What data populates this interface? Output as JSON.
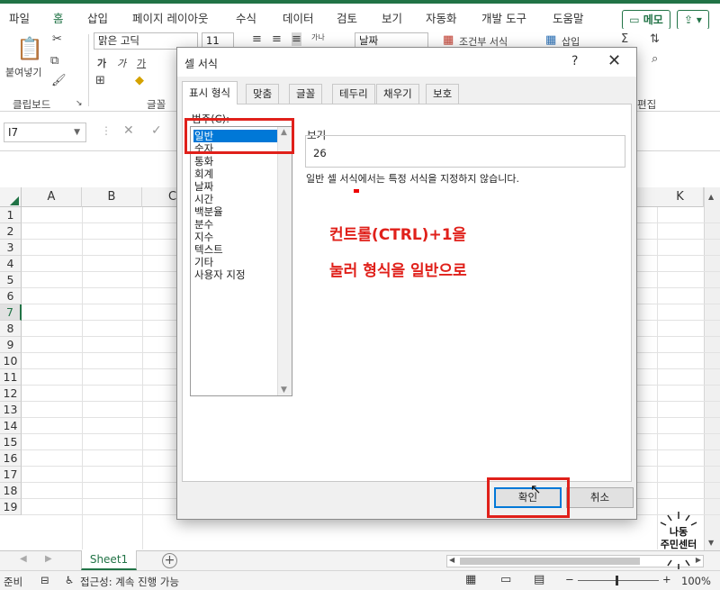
{
  "ribbon_tabs": [
    "파일",
    "홈",
    "삽입",
    "페이지 레이아웃",
    "수식",
    "데이터",
    "검토",
    "보기",
    "자동화",
    "개발 도구",
    "도움말"
  ],
  "memo_label": "메모",
  "ribbon": {
    "paste_label": "붙여넣기",
    "font_name": "맑은 고딕",
    "font_size": "11",
    "number_format": "날짜",
    "conditional_format": "조건부 서식",
    "insert_label": "삽입",
    "group_clipboard": "클립보드",
    "group_font": "글꼴",
    "group_edit": "편집",
    "bold": "가",
    "italic": "가",
    "underline": "가",
    "wrap": "가나"
  },
  "formula_bar": {
    "name_box": "I7",
    "cancel": "✕",
    "confirm": "✓"
  },
  "grid": {
    "columns": [
      "A",
      "B",
      "C",
      "K"
    ],
    "rows": [
      "1",
      "2",
      "3",
      "4",
      "5",
      "6",
      "7",
      "8",
      "9",
      "10",
      "11",
      "12",
      "13",
      "14",
      "15",
      "16",
      "17",
      "18",
      "19"
    ],
    "selected_row": "7"
  },
  "sheet_tab": "Sheet1",
  "status": {
    "ready": "준비",
    "accessibility": "접근성: 계속 진행 가능",
    "zoom": "100%"
  },
  "dialog": {
    "title": "셀 서식",
    "help": "?",
    "close": "✕",
    "tabs": [
      "표시 형식",
      "맞춤",
      "글꼴",
      "테두리",
      "채우기",
      "보호"
    ],
    "category_label": "범주(C):",
    "categories": [
      "일반",
      "숫자",
      "통화",
      "회계",
      "날짜",
      "시간",
      "백분율",
      "분수",
      "지수",
      "텍스트",
      "기타",
      "사용자 지정"
    ],
    "selected_category": "일반",
    "sample_label": "보기",
    "sample_value": "26",
    "description": "일반 셀 서식에서는 특정 서식을 지정하지 않습니다.",
    "ok": "확인",
    "cancel": "취소"
  },
  "annotation": {
    "line1": "컨트롤(CTRL)+1을",
    "line2": "눌러 형식을 일반으로"
  },
  "watermark": {
    "line1": "나동",
    "line2": "주민센터"
  },
  "colors": {
    "excel_green": "#217346",
    "highlight_red": "#e0201a",
    "selection_blue": "#0078d7"
  }
}
